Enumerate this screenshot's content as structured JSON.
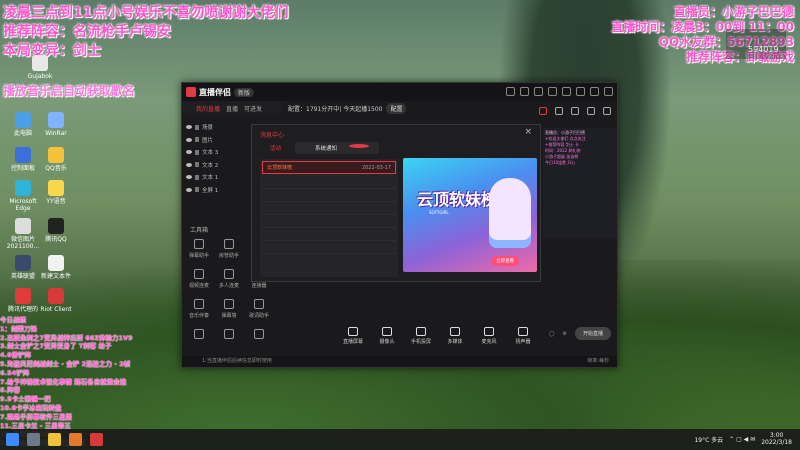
{
  "overlay": {
    "line1": "凌晨三点到11点小号娱乐不喜勿喷谢谢大佬们",
    "line2": "推荐阵容：名流枪手卢锡安",
    "line3": "本局变异：剑士",
    "line4": "播放音乐启自动获取歌名",
    "right1": "直播员：小游子巴巴德",
    "right2": "直播时间：凌晨3：00到 11：00",
    "right3": "QQ水友群：56712893",
    "right4": "推荐阵容：卸载游戏",
    "right_box_num": "594019"
  },
  "desktop_icons": [
    {
      "label": "Gujabok",
      "color": "#e8e8e8"
    },
    {
      "label": "此电脑",
      "color": "#4aa0e8"
    },
    {
      "label": "WinRar",
      "color": "#7fb2ff"
    },
    {
      "label": "控制面板",
      "color": "#3d6fd8"
    },
    {
      "label": "QQ音乐",
      "color": "#f3c23b"
    },
    {
      "label": "Microsoft Edge",
      "color": "#2db4d8"
    },
    {
      "label": "YY语音",
      "color": "#f6d84a"
    },
    {
      "label": "微信图片 2021100...",
      "color": "#dddddd"
    },
    {
      "label": "腾讯QQ",
      "color": "#222222"
    },
    {
      "label": "英雄联盟",
      "color": "#3a4a6a"
    },
    {
      "label": "新建文本件",
      "color": "#f2f2f2"
    },
    {
      "label": "腾讯代理的",
      "color": "#e03b3b"
    },
    {
      "label": "Riot Client",
      "color": "#d83a3a"
    }
  ],
  "left_list": [
    "今日战绩",
    "1：剑荣刀锋",
    "2.杰斯鱼刺之7变异战神杰斯 66Z体验力1V9",
    "3.剑士金铲之7变异变身了 T刺客 给子",
    "4.6份铲阵",
    "5.海盗风范剑战剑士 - 金铲 2连胜之力 - 2帧",
    "6.S4铲阵",
    "7.给予神秘技术强化事情 赌石各自就做会选",
    "8.阵容",
    "9.S卡士猴镜一把",
    "10.6卡手冰出玩转盘",
    "7.路路手屏幕软件三星版",
    "11.三星卡兰 - 三星帝王",
    "12.卡卡鱼刺大剑",
    "13.剑战金铲小猫咪 金铲装机"
  ],
  "window": {
    "app_name": "直播伴侣",
    "version": "新版",
    "tabs": [
      "我的直播",
      "直播",
      "可进发"
    ],
    "info_text": "配置：1791分开中| 今天起播1500",
    "info_button": "配置",
    "scenes": [
      "场景",
      "图片",
      "文本 3",
      "文本 2",
      "文本 1",
      "全屏 1"
    ],
    "tools_title": "工具箱",
    "tools": [
      "弹幕助手",
      "房管助手",
      "",
      "视频连麦",
      "多人连麦",
      "连接器",
      "音乐伴奏",
      "弹幕墙",
      "歌词助手",
      "",
      "",
      ""
    ],
    "controls": [
      "直播屏幕",
      "摄像头",
      "手机投屏",
      "多媒体",
      "麦克风",
      "扬声器"
    ],
    "start_button": "开始直播",
    "bottom_text": "1:当直播伴侣后续信息即时使用",
    "bottom_right": "帧率:每秒"
  },
  "popup": {
    "title": "消息中心",
    "close": "×",
    "tabs": [
      "活动",
      "系统通知"
    ],
    "item_name": "云顶软妹榜",
    "item_date": "2022-03-17",
    "banner_title": "云顶软妹榜",
    "banner_sub": "SOFTGIRL",
    "banner_cta": "立即查看"
  },
  "chat": {
    "header": "直播员：小游子巴巴德",
    "lines": [
      "+欢迎大佬们 点点关注",
      "+推荐阵容  剑士 卡",
      "时间：2022 刷礼物",
      "小游子超级 加油啊",
      "今日10连胜 开心 "
    ]
  },
  "taskbar": {
    "weather": "19°C 多云",
    "time": "3:00",
    "date": "2022/3/18"
  }
}
